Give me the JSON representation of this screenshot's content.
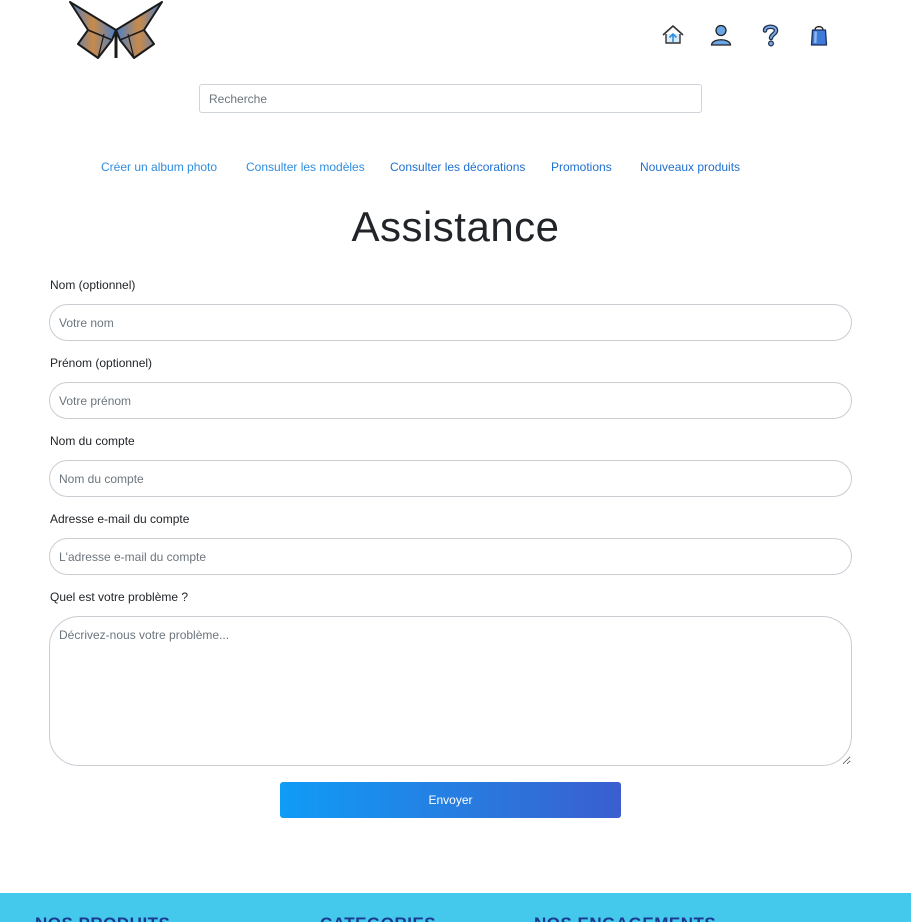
{
  "header": {
    "logo_icon": "butterfly-logo",
    "icons": [
      "home-icon",
      "user-icon",
      "help-icon",
      "cart-bag-icon"
    ]
  },
  "search": {
    "placeholder": "Recherche",
    "value": ""
  },
  "nav": {
    "items": [
      {
        "label": "Créer un album photo",
        "color": "#2f8ee0"
      },
      {
        "label": "Consulter les modèles",
        "color": "#2f8ee0"
      },
      {
        "label": "Consulter les décorations",
        "color": "#1f6fd0"
      },
      {
        "label": "Promotions",
        "color": "#1f6fd0"
      },
      {
        "label": "Nouveaux produits",
        "color": "#1f6fd0"
      }
    ]
  },
  "page": {
    "title": "Assistance"
  },
  "form": {
    "fields": [
      {
        "label": "Nom (optionnel)",
        "placeholder": "Votre nom",
        "value": ""
      },
      {
        "label": "Prénom (optionnel)",
        "placeholder": "Votre prénom",
        "value": ""
      },
      {
        "label": "Nom du compte",
        "placeholder": "Nom du compte",
        "value": ""
      },
      {
        "label": "Adresse e-mail du compte",
        "placeholder": "L'adresse e-mail du compte",
        "value": ""
      }
    ],
    "problem": {
      "label": "Quel est votre problème ?",
      "placeholder": "Décrivez-nous votre problème...",
      "value": ""
    },
    "submit_label": "Envoyer"
  },
  "footer": {
    "background": "#44c8ec",
    "headings": [
      "NOS PRODUITS",
      "CATEGORIES",
      "NOS ENGAGEMENTS"
    ]
  },
  "colors": {
    "accent": "#1f6fd0",
    "button_start": "#0f9cf7",
    "button_end": "#3a5ecf"
  }
}
